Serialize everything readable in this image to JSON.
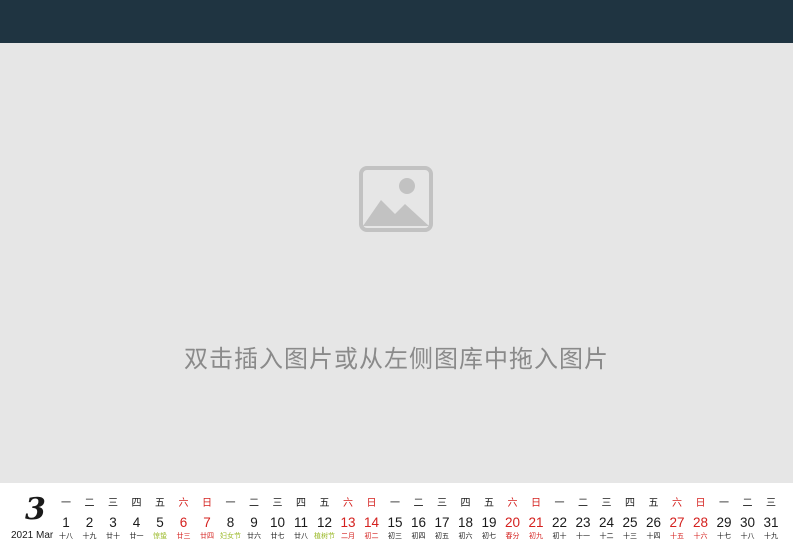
{
  "placeholder": {
    "text": "双击插入图片或从左侧图库中拖入图片",
    "icon": "image-placeholder-icon"
  },
  "calendar": {
    "month_number": "3",
    "month_label": "2021 Mar",
    "colors": {
      "normal": "#1a1a1a",
      "weekend": "#d4201e",
      "festival": "#9bba2a"
    },
    "days": [
      {
        "wd": "一",
        "d": "1",
        "l": "十八",
        "type": "normal"
      },
      {
        "wd": "二",
        "d": "2",
        "l": "十九",
        "type": "normal"
      },
      {
        "wd": "三",
        "d": "3",
        "l": "廿十",
        "type": "normal"
      },
      {
        "wd": "四",
        "d": "4",
        "l": "廿一",
        "type": "normal"
      },
      {
        "wd": "五",
        "d": "5",
        "l": "惊蛰",
        "type": "festival"
      },
      {
        "wd": "六",
        "d": "6",
        "l": "廿三",
        "type": "weekend"
      },
      {
        "wd": "日",
        "d": "7",
        "l": "廿四",
        "type": "weekend"
      },
      {
        "wd": "一",
        "d": "8",
        "l": "妇女节",
        "type": "festival"
      },
      {
        "wd": "二",
        "d": "9",
        "l": "廿六",
        "type": "normal"
      },
      {
        "wd": "三",
        "d": "10",
        "l": "廿七",
        "type": "normal"
      },
      {
        "wd": "四",
        "d": "11",
        "l": "廿八",
        "type": "normal"
      },
      {
        "wd": "五",
        "d": "12",
        "l": "植树节",
        "type": "festival"
      },
      {
        "wd": "六",
        "d": "13",
        "l": "二月",
        "type": "weekend"
      },
      {
        "wd": "日",
        "d": "14",
        "l": "初二",
        "type": "weekend"
      },
      {
        "wd": "一",
        "d": "15",
        "l": "初三",
        "type": "normal"
      },
      {
        "wd": "二",
        "d": "16",
        "l": "初四",
        "type": "normal"
      },
      {
        "wd": "三",
        "d": "17",
        "l": "初五",
        "type": "normal"
      },
      {
        "wd": "四",
        "d": "18",
        "l": "初六",
        "type": "normal"
      },
      {
        "wd": "五",
        "d": "19",
        "l": "初七",
        "type": "normal"
      },
      {
        "wd": "六",
        "d": "20",
        "l": "春分",
        "type": "weekend"
      },
      {
        "wd": "日",
        "d": "21",
        "l": "初九",
        "type": "weekend"
      },
      {
        "wd": "一",
        "d": "22",
        "l": "初十",
        "type": "normal"
      },
      {
        "wd": "二",
        "d": "23",
        "l": "十一",
        "type": "normal"
      },
      {
        "wd": "三",
        "d": "24",
        "l": "十二",
        "type": "normal"
      },
      {
        "wd": "四",
        "d": "25",
        "l": "十三",
        "type": "normal"
      },
      {
        "wd": "五",
        "d": "26",
        "l": "十四",
        "type": "normal"
      },
      {
        "wd": "六",
        "d": "27",
        "l": "十五",
        "type": "weekend"
      },
      {
        "wd": "日",
        "d": "28",
        "l": "十六",
        "type": "weekend"
      },
      {
        "wd": "一",
        "d": "29",
        "l": "十七",
        "type": "normal"
      },
      {
        "wd": "二",
        "d": "30",
        "l": "十八",
        "type": "normal"
      },
      {
        "wd": "三",
        "d": "31",
        "l": "十九",
        "type": "normal"
      }
    ]
  }
}
